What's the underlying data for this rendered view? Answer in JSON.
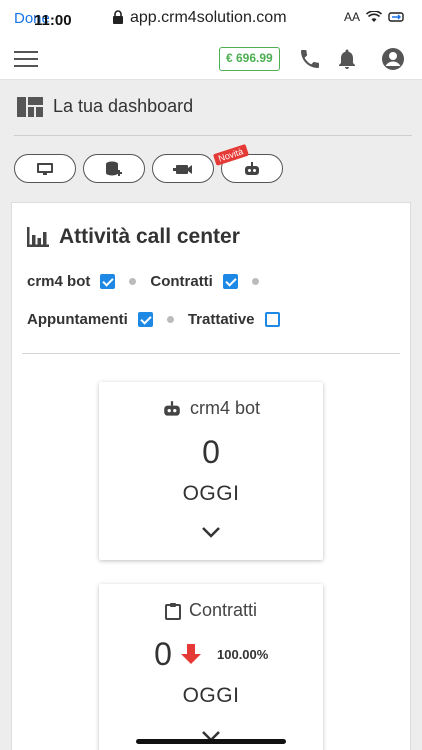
{
  "status_bar": {
    "done": "Done",
    "time": "11:00",
    "url": "app.crm4solution.com"
  },
  "header": {
    "credit": "€ 696.99"
  },
  "dashboard": {
    "title": "La tua dashboard",
    "new_badge": "Novità"
  },
  "card": {
    "title": "Attività call center",
    "filters": [
      {
        "label": "crm4 bot",
        "checked": true
      },
      {
        "label": "Contratti",
        "checked": true
      },
      {
        "label": "Appuntamenti",
        "checked": true
      },
      {
        "label": "Trattative",
        "checked": false
      }
    ],
    "stats": [
      {
        "title": "crm4 bot",
        "value": "0",
        "period": "OGGI"
      },
      {
        "title": "Contratti",
        "value": "0",
        "period": "OGGI",
        "change": "100.00%",
        "trend": "down"
      }
    ]
  },
  "colors": {
    "accent": "#1e88e5",
    "credit": "#4caf50",
    "alert": "#e53935"
  }
}
